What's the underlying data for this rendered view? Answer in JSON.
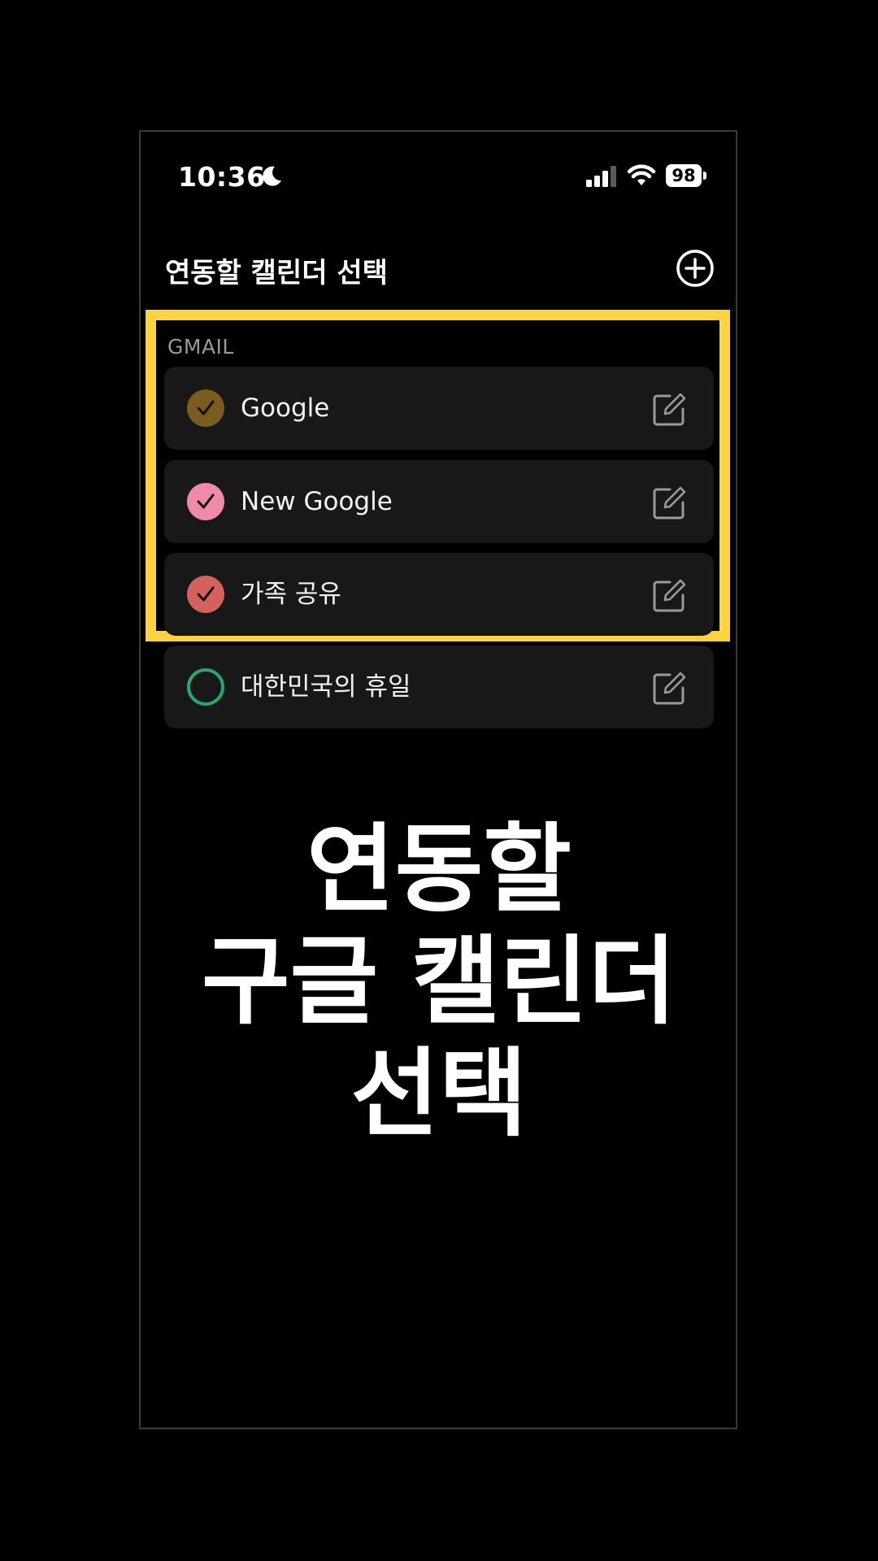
{
  "status_bar": {
    "time": "10:36",
    "battery": "98"
  },
  "header": {
    "title": "연동할 캘린더 선택"
  },
  "section": {
    "label": "GMAIL"
  },
  "calendars": [
    {
      "label": "Google",
      "checked": true,
      "color": "#7a5c1e"
    },
    {
      "label": "New Google",
      "checked": true,
      "color": "#f08aa8"
    },
    {
      "label": "가족 공유",
      "checked": true,
      "color": "#d4625c"
    },
    {
      "label": "대한민국의 휴일",
      "checked": false,
      "color": "#27a86a"
    }
  ],
  "caption": {
    "line1": "연동할",
    "line2": "구글 캘린더",
    "line3": "선택"
  },
  "colors": {
    "highlight": "#ffd23f",
    "row_background": "#181818",
    "background": "#000000"
  },
  "icons": {
    "moon": "moon-icon",
    "signal": "cellular-signal-icon",
    "wifi": "wifi-icon",
    "add": "plus-circle-icon",
    "edit": "edit-icon",
    "check": "checkmark-icon"
  }
}
